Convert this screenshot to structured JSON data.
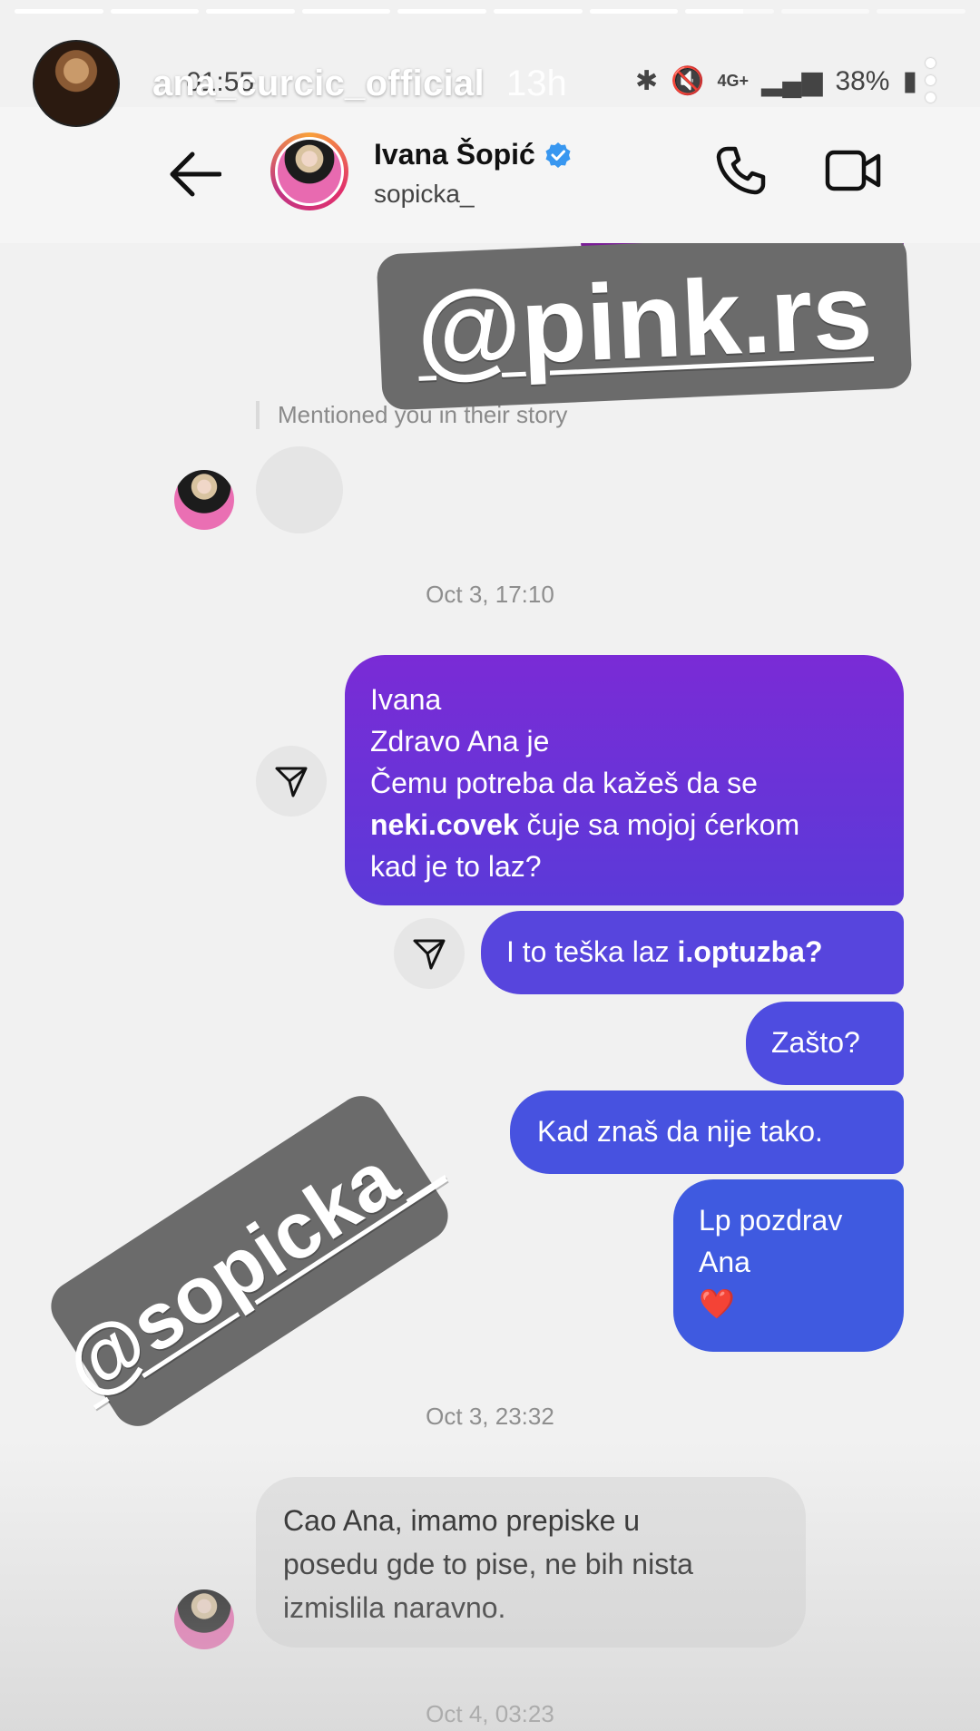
{
  "story": {
    "username": "ana_curcic_official",
    "time_ago": "13h",
    "progress_segments": [
      1,
      1,
      1,
      1,
      1,
      1,
      1,
      0.65,
      0,
      0
    ]
  },
  "status_bar": {
    "time": "01:55",
    "network": "4G+",
    "battery": "38%"
  },
  "chat_header": {
    "name": "Ivana Šopić",
    "handle": "sopicka_",
    "verified": true
  },
  "stickers": {
    "pink": "@pink.rs",
    "sopicka": "@sopicka_"
  },
  "mention_text": "Mentioned you in their story",
  "timestamps": [
    "Oct 3, 17:10",
    "Oct 3, 23:32",
    "Oct 4, 03:23"
  ],
  "messages": {
    "m1": {
      "line1": "Ivana",
      "line2": "Zdravo Ana je",
      "line3": "Čemu potreba da kažeš da se",
      "line4_bold": "neki.covek",
      "line4_rest": " čuje sa mojoj ćerkom",
      "line5": "kad je to laz?"
    },
    "m2": {
      "text": "I to teška laz ",
      "bold": "i.optuzba?"
    },
    "m3": {
      "text": "Zašto?"
    },
    "m4": {
      "text": "Kad znaš da nije tako."
    },
    "m5": {
      "line1": "Lp pozdrav",
      "line2": "Ana",
      "line3": "❤️"
    },
    "m6": {
      "line1": "Cao Ana, imamo prepiske u",
      "line2": "posedu gde to pise, ne bih nista",
      "line3": "izmislila naravno."
    }
  },
  "colors": {
    "bubble_purple": "#7a2bd6",
    "bubble_blue": "#3f5ae0",
    "bubble_gray": "#e2e2e2",
    "verified_blue": "#3897f0",
    "sticker_gray": "#6b6b6b"
  }
}
